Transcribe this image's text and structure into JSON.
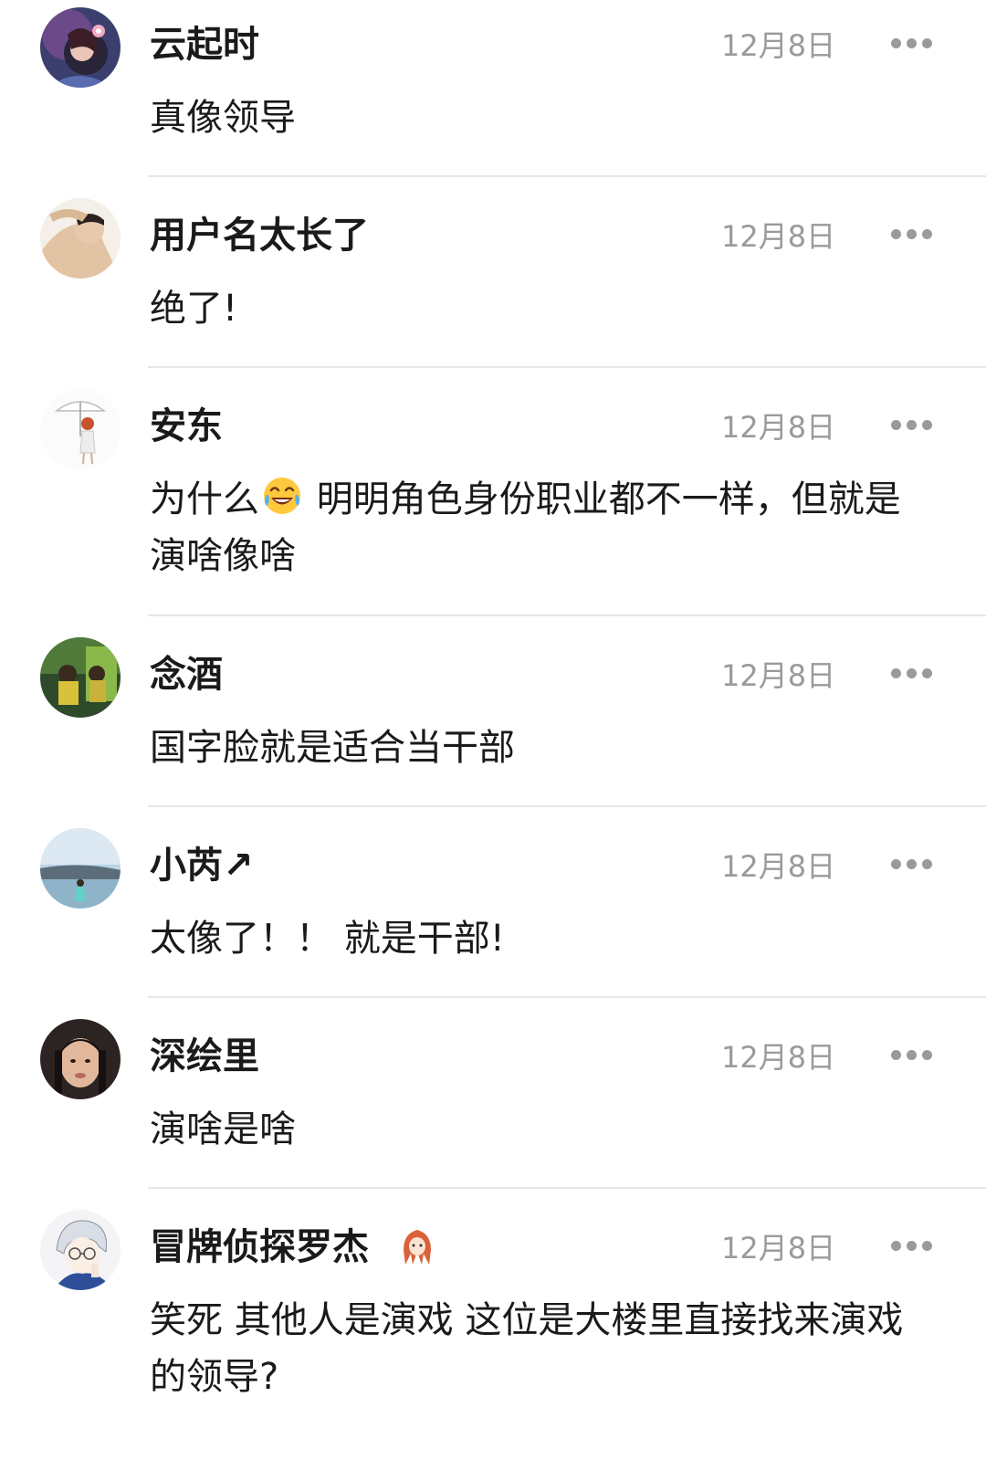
{
  "comments": [
    {
      "name": "云起时",
      "date": "12月8日",
      "text": "真像领导",
      "avatar": "avatar-girl-flower"
    },
    {
      "name": "用户名太长了",
      "date": "12月8日",
      "text": "绝了!",
      "avatar": "avatar-person-arm"
    },
    {
      "name": "安东",
      "date": "12月8日",
      "text_before": "为什么",
      "emoji": "tears-of-joy-emoji",
      "text_after": " 明明角色身份职业都不一样，但就是演啥像啥",
      "avatar": "avatar-umbrella-girl"
    },
    {
      "name": "念酒",
      "date": "12月8日",
      "text": "国字脸就是适合当干部",
      "avatar": "avatar-green-scene"
    },
    {
      "name": "小芮↗",
      "date": "12月8日",
      "text": "太像了！！ 就是干部!",
      "avatar": "avatar-seaside"
    },
    {
      "name": "深绘里",
      "date": "12月8日",
      "text": "演啥是啥",
      "avatar": "avatar-girl-portrait"
    },
    {
      "name": "冒牌侦探罗杰",
      "date": "12月8日",
      "text": "笑死 其他人是演戏 这位是大楼里直接找来演戏的领导?",
      "avatar": "avatar-anime-glasses",
      "badge": "character-badge-icon"
    }
  ],
  "more_icon": "more-options-icon",
  "colors": {
    "name": "#1a1a1a",
    "text": "#1a1a1a",
    "date": "#9a9a9a",
    "divider": "#e6e6e6"
  }
}
